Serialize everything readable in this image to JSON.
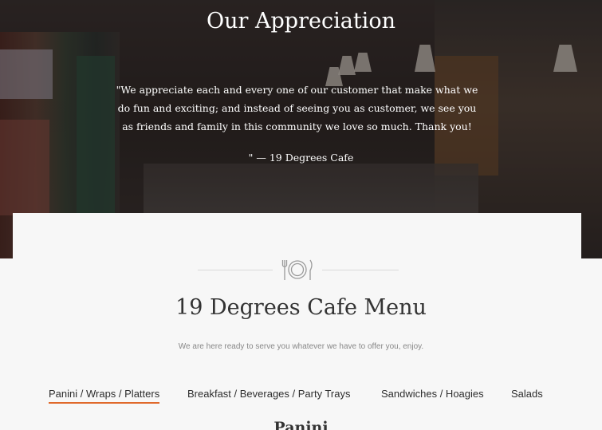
{
  "hero": {
    "title": "Our Appreciation",
    "quote": "\"We appreciate each and every one of our customer that make what we do fun and exciting; and instead of seeing you as customer, we see you as friends and family in this community we love so much. Thank you!",
    "signature": "\" — 19 Degrees Cafe"
  },
  "menu": {
    "title": "19 Degrees Cafe Menu",
    "subtitle": "We are here ready to serve you whatever we have to offer you, enjoy.",
    "tabs": [
      {
        "label": "Panini / Wraps / Platters",
        "active": true
      },
      {
        "label": "Breakfast / Beverages / Party Trays",
        "active": false
      },
      {
        "label": "Sandwiches / Hoagies",
        "active": false
      },
      {
        "label": "Salads",
        "active": false
      }
    ],
    "section_heading": "Panini"
  },
  "colors": {
    "accent": "#e0692b",
    "text_dark": "#333333",
    "text_muted": "#888888"
  },
  "icons": {
    "divider": "plate-fork-knife-icon"
  }
}
